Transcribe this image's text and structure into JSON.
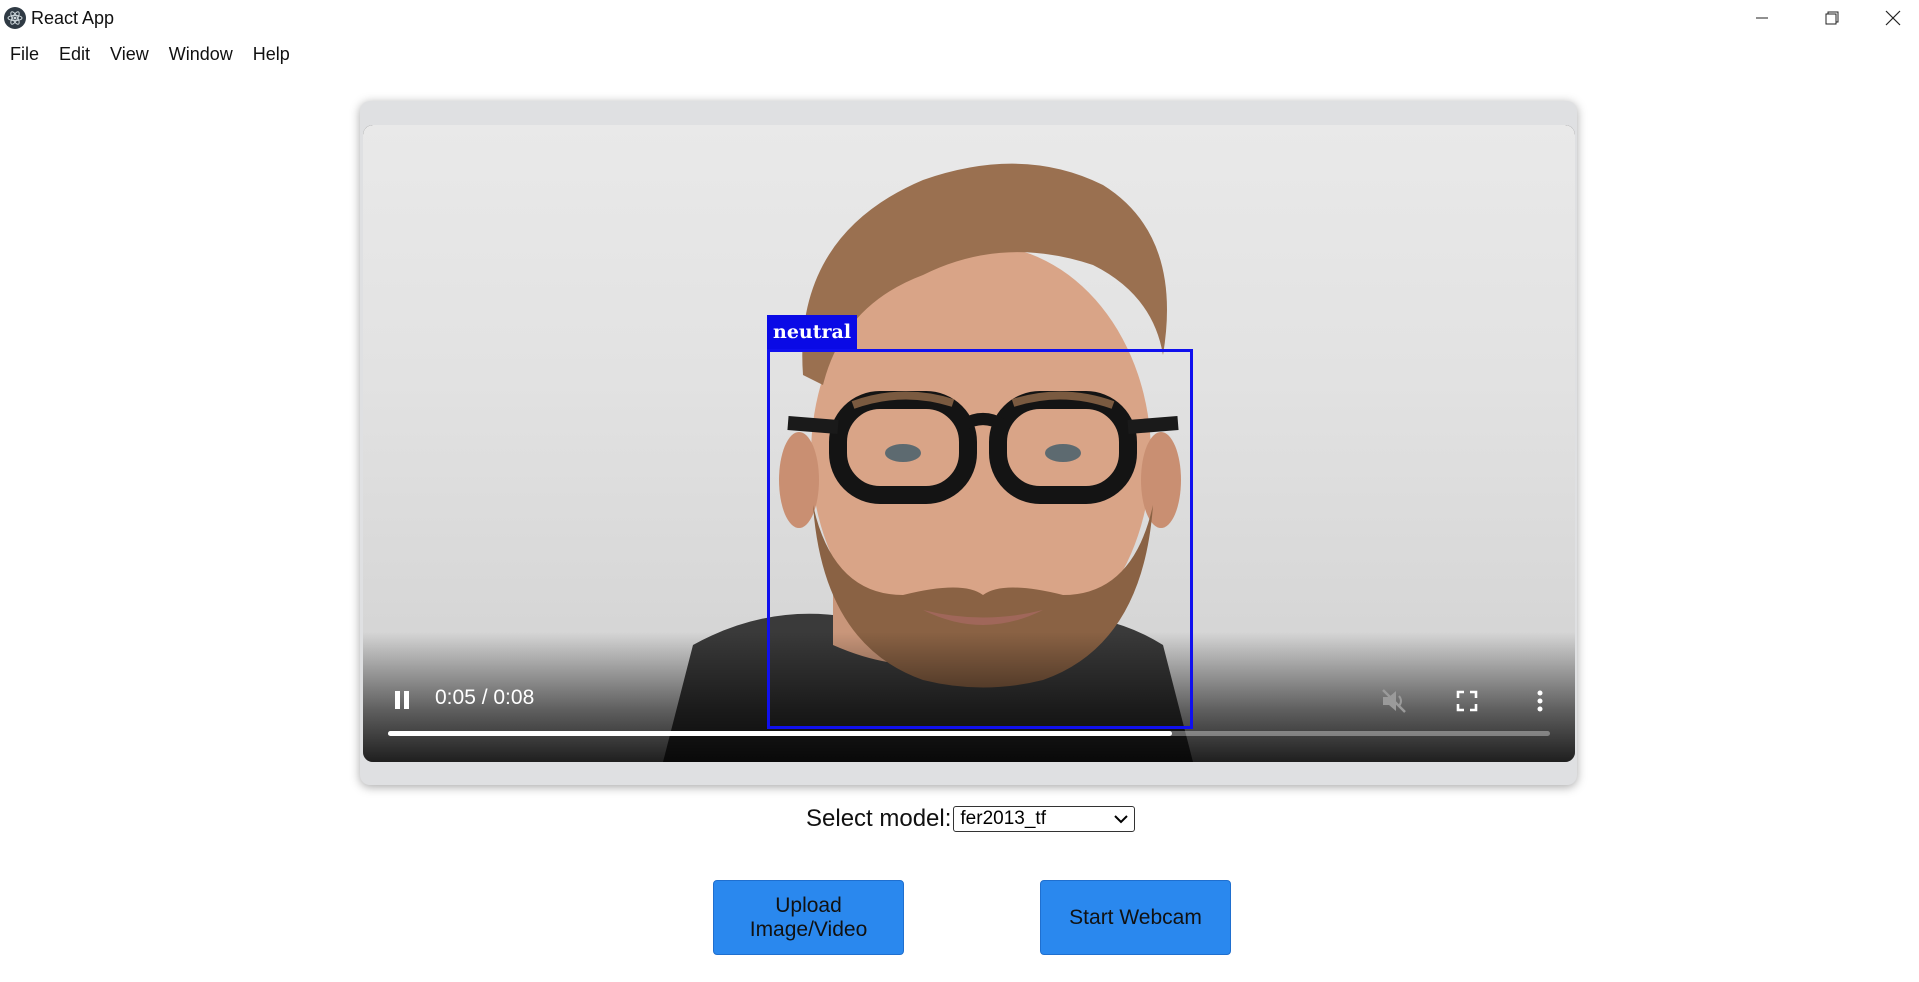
{
  "window": {
    "title": "React App",
    "controls": [
      "minimize-icon",
      "maximize-icon",
      "close-icon"
    ]
  },
  "menu": {
    "items": [
      "File",
      "Edit",
      "View",
      "Window",
      "Help"
    ]
  },
  "video": {
    "detection_label": "neutral",
    "time_display": "0:05 / 0:08",
    "progress": 0.675,
    "icons": {
      "play_state": "pause-icon",
      "mute": "mute-icon",
      "fullscreen": "fullscreen-icon",
      "more": "more-options-icon"
    },
    "colors": {
      "bbox": "#1010ee"
    }
  },
  "model": {
    "label": "Select model:",
    "selected": "fer2013_tf"
  },
  "buttons": {
    "upload": "Upload Image/Video",
    "webcam": "Start Webcam"
  },
  "colors": {
    "button": "#2a88ee"
  }
}
